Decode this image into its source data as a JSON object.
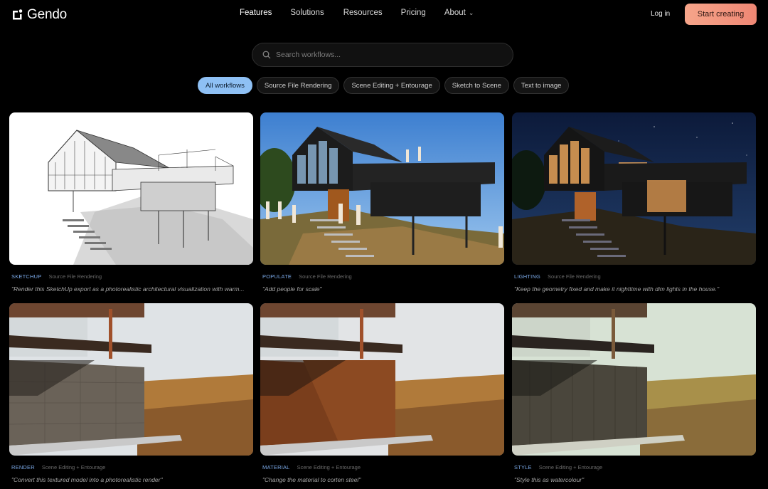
{
  "brand": {
    "name": "Gendo"
  },
  "nav": {
    "items": [
      {
        "label": "Features",
        "active": true
      },
      {
        "label": "Solutions"
      },
      {
        "label": "Resources"
      },
      {
        "label": "Pricing"
      },
      {
        "label": "About",
        "has_dropdown": true
      }
    ],
    "login_label": "Log in",
    "cta_label": "Start creating"
  },
  "search": {
    "placeholder": "Search workflows...",
    "value": ""
  },
  "filters": [
    {
      "label": "All workflows",
      "active": true
    },
    {
      "label": "Source File Rendering"
    },
    {
      "label": "Scene Editing + Entourage"
    },
    {
      "label": "Sketch to Scene"
    },
    {
      "label": "Text to image"
    }
  ],
  "cards": [
    {
      "tag": "SKETCHUP",
      "category": "Source File Rendering",
      "prompt": "\"Render this SketchUp export as a photorealistic architectural visualization with warm...",
      "style": "sketch"
    },
    {
      "tag": "POPULATE",
      "category": "Source File Rendering",
      "prompt": "\"Add people for scale\"",
      "style": "day"
    },
    {
      "tag": "LIGHTING",
      "category": "Source File Rendering",
      "prompt": "\"Keep the geometry fixed and make it nighttime with dim lights in the house.\"",
      "style": "night"
    },
    {
      "tag": "RENDER",
      "category": "Scene Editing + Entourage",
      "prompt": "\"Convert this textured model into a photorealistic render\"",
      "style": "stone"
    },
    {
      "tag": "MATERIAL",
      "category": "Scene Editing + Entourage",
      "prompt": "\"Change the material to corten steel\"",
      "style": "corten"
    },
    {
      "tag": "STYLE",
      "category": "Scene Editing + Entourage",
      "prompt": "\"Style this as watercolour\"",
      "style": "watercolour"
    }
  ],
  "colors": {
    "accent": "#8ec0f4",
    "cta": "#ef8774",
    "tag": "#7aa8e6",
    "background": "#000000"
  }
}
